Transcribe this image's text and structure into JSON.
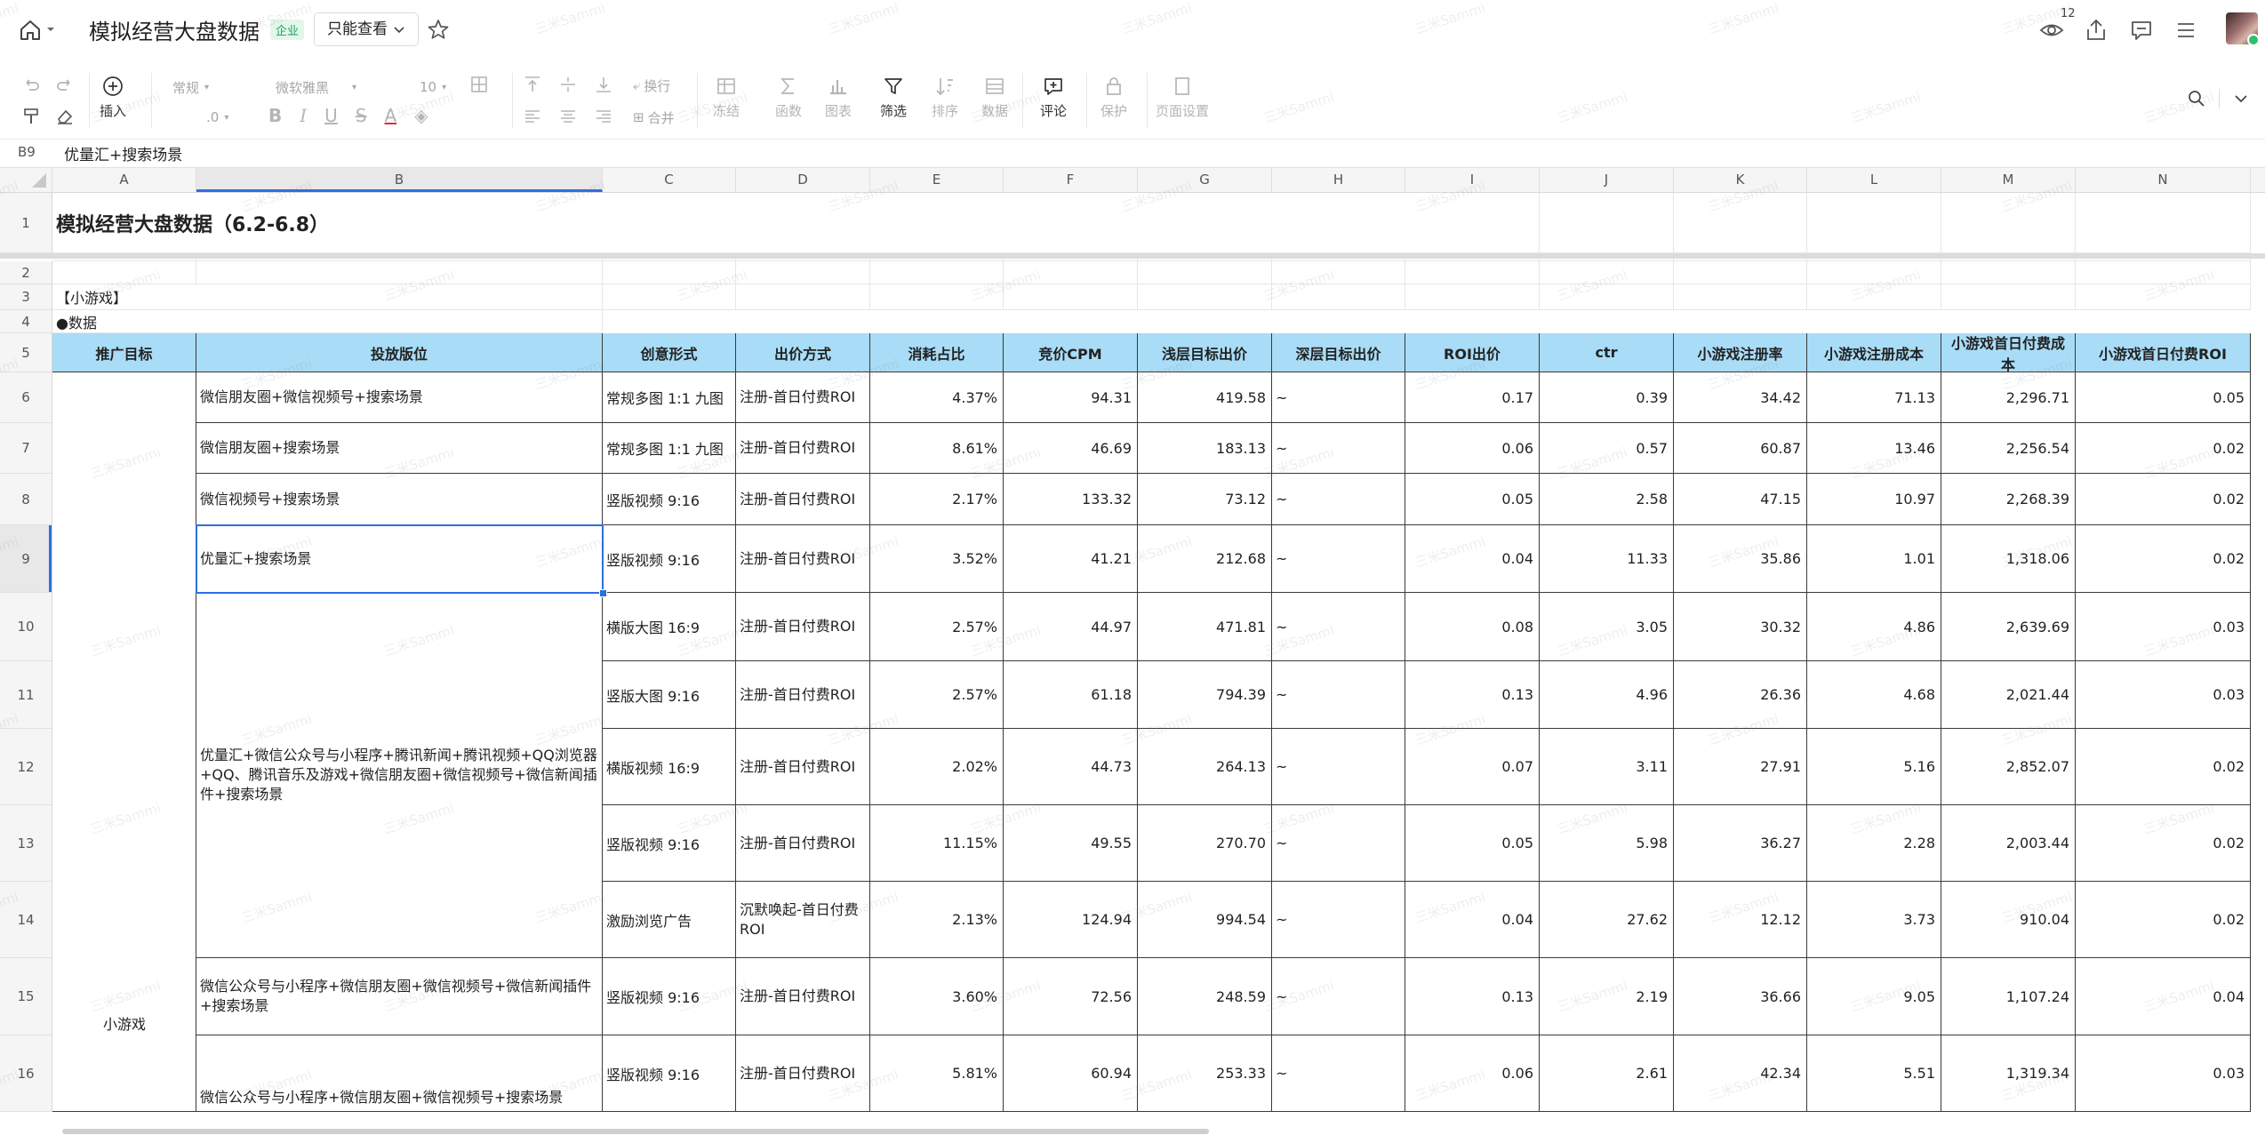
{
  "titlebar": {
    "doc_title": "模拟经营大盘数据",
    "badge": "企业",
    "mode_label": "只能查看",
    "viewer_count": "12"
  },
  "toolbar": {
    "insert": "插入",
    "font_format": "常规",
    "font_name": "微软雅黑",
    "font_size": "10",
    "decimal": ".0",
    "wrap": "换行",
    "merge": "合并",
    "freeze": "冻结",
    "function": "函数",
    "chart": "图表",
    "filter": "筛选",
    "sort": "排序",
    "data": "数据",
    "comment": "评论",
    "protect": "保护",
    "page_setup": "页面设置"
  },
  "formula_bar": {
    "cell_ref": "B9",
    "value": "优量汇+搜索场景"
  },
  "columns": [
    "A",
    "B",
    "C",
    "D",
    "E",
    "F",
    "G",
    "H",
    "I",
    "J",
    "K",
    "L",
    "M",
    "N"
  ],
  "rows": [
    "1",
    "2",
    "3",
    "4",
    "5",
    "6",
    "7",
    "8",
    "9",
    "10",
    "11",
    "12",
    "13",
    "14",
    "15",
    "16"
  ],
  "sheet": {
    "title": "模拟经营大盘数据（6.2-6.8）",
    "section_label": "【小游戏】",
    "sub_label": "●数据",
    "group_label": "小游戏",
    "headers": [
      "推广目标",
      "投放版位",
      "创意形式",
      "出价方式",
      "消耗占比",
      "竞价CPM",
      "浅层目标出价",
      "深层目标出价",
      "ROI出价",
      "ctr",
      "小游戏注册率",
      "小游戏注册成本",
      "小游戏首日付费成本",
      "小游戏首日付费ROI"
    ],
    "placements": {
      "r6": "微信朋友圈+微信视频号+搜索场景",
      "r7": "微信朋友圈+搜索场景",
      "r8": "微信视频号+搜索场景",
      "r9": "优量汇+搜索场景",
      "r10_14": "优量汇+微信公众号与小程序+腾讯新闻+腾讯视频+QQ浏览器+QQ、腾讯音乐及游戏+微信朋友圈+微信视频号+微信新闻插件+搜索场景",
      "r15": "微信公众号与小程序+微信朋友圈+微信视频号+微信新闻插件+搜索场景",
      "r16": "微信公众号与小程序+微信朋友圈+微信视频号+搜索场景"
    },
    "data_rows": [
      {
        "creative": "常规多图 1:1 九图",
        "bid": "注册-首日付费ROI",
        "cost": "4.37%",
        "cpm": "94.31",
        "shallow": "419.58",
        "deep": "~",
        "roi_bid": "0.17",
        "ctr": "0.39",
        "reg_rate": "34.42",
        "reg_cost": "71.13",
        "pay_cost": "2,296.71",
        "pay_roi": "0.05"
      },
      {
        "creative": "常规多图 1:1 九图",
        "bid": "注册-首日付费ROI",
        "cost": "8.61%",
        "cpm": "46.69",
        "shallow": "183.13",
        "deep": "~",
        "roi_bid": "0.06",
        "ctr": "0.57",
        "reg_rate": "60.87",
        "reg_cost": "13.46",
        "pay_cost": "2,256.54",
        "pay_roi": "0.02"
      },
      {
        "creative": "竖版视频 9:16",
        "bid": "注册-首日付费ROI",
        "cost": "2.17%",
        "cpm": "133.32",
        "shallow": "73.12",
        "deep": "~",
        "roi_bid": "0.05",
        "ctr": "2.58",
        "reg_rate": "47.15",
        "reg_cost": "10.97",
        "pay_cost": "2,268.39",
        "pay_roi": "0.02"
      },
      {
        "creative": "竖版视频 9:16",
        "bid": "注册-首日付费ROI",
        "cost": "3.52%",
        "cpm": "41.21",
        "shallow": "212.68",
        "deep": "~",
        "roi_bid": "0.04",
        "ctr": "11.33",
        "reg_rate": "35.86",
        "reg_cost": "1.01",
        "pay_cost": "1,318.06",
        "pay_roi": "0.02"
      },
      {
        "creative": "横版大图 16:9",
        "bid": "注册-首日付费ROI",
        "cost": "2.57%",
        "cpm": "44.97",
        "shallow": "471.81",
        "deep": "~",
        "roi_bid": "0.08",
        "ctr": "3.05",
        "reg_rate": "30.32",
        "reg_cost": "4.86",
        "pay_cost": "2,639.69",
        "pay_roi": "0.03"
      },
      {
        "creative": "竖版大图 9:16",
        "bid": "注册-首日付费ROI",
        "cost": "2.57%",
        "cpm": "61.18",
        "shallow": "794.39",
        "deep": "~",
        "roi_bid": "0.13",
        "ctr": "4.96",
        "reg_rate": "26.36",
        "reg_cost": "4.68",
        "pay_cost": "2,021.44",
        "pay_roi": "0.03"
      },
      {
        "creative": "横版视频 16:9",
        "bid": "注册-首日付费ROI",
        "cost": "2.02%",
        "cpm": "44.73",
        "shallow": "264.13",
        "deep": "~",
        "roi_bid": "0.07",
        "ctr": "3.11",
        "reg_rate": "27.91",
        "reg_cost": "5.16",
        "pay_cost": "2,852.07",
        "pay_roi": "0.02"
      },
      {
        "creative": "竖版视频 9:16",
        "bid": "注册-首日付费ROI",
        "cost": "11.15%",
        "cpm": "49.55",
        "shallow": "270.70",
        "deep": "~",
        "roi_bid": "0.05",
        "ctr": "5.98",
        "reg_rate": "36.27",
        "reg_cost": "2.28",
        "pay_cost": "2,003.44",
        "pay_roi": "0.02"
      },
      {
        "creative": "激励浏览广告",
        "bid": "沉默唤起-首日付费ROI",
        "cost": "2.13%",
        "cpm": "124.94",
        "shallow": "994.54",
        "deep": "~",
        "roi_bid": "0.04",
        "ctr": "27.62",
        "reg_rate": "12.12",
        "reg_cost": "3.73",
        "pay_cost": "910.04",
        "pay_roi": "0.02"
      },
      {
        "creative": "竖版视频 9:16",
        "bid": "注册-首日付费ROI",
        "cost": "3.60%",
        "cpm": "72.56",
        "shallow": "248.59",
        "deep": "~",
        "roi_bid": "0.13",
        "ctr": "2.19",
        "reg_rate": "36.66",
        "reg_cost": "9.05",
        "pay_cost": "1,107.24",
        "pay_roi": "0.04"
      },
      {
        "creative": "竖版视频 9:16",
        "bid": "注册-首日付费ROI",
        "cost": "5.81%",
        "cpm": "60.94",
        "shallow": "253.33",
        "deep": "~",
        "roi_bid": "0.06",
        "ctr": "2.61",
        "reg_rate": "42.34",
        "reg_cost": "5.51",
        "pay_cost": "1,319.34",
        "pay_roi": "0.03"
      }
    ]
  },
  "watermark": "三米Sammi",
  "colors": {
    "header_fill": "#a9dcf6",
    "selection": "#2c6fe0",
    "badge_text": "#1aa259"
  }
}
